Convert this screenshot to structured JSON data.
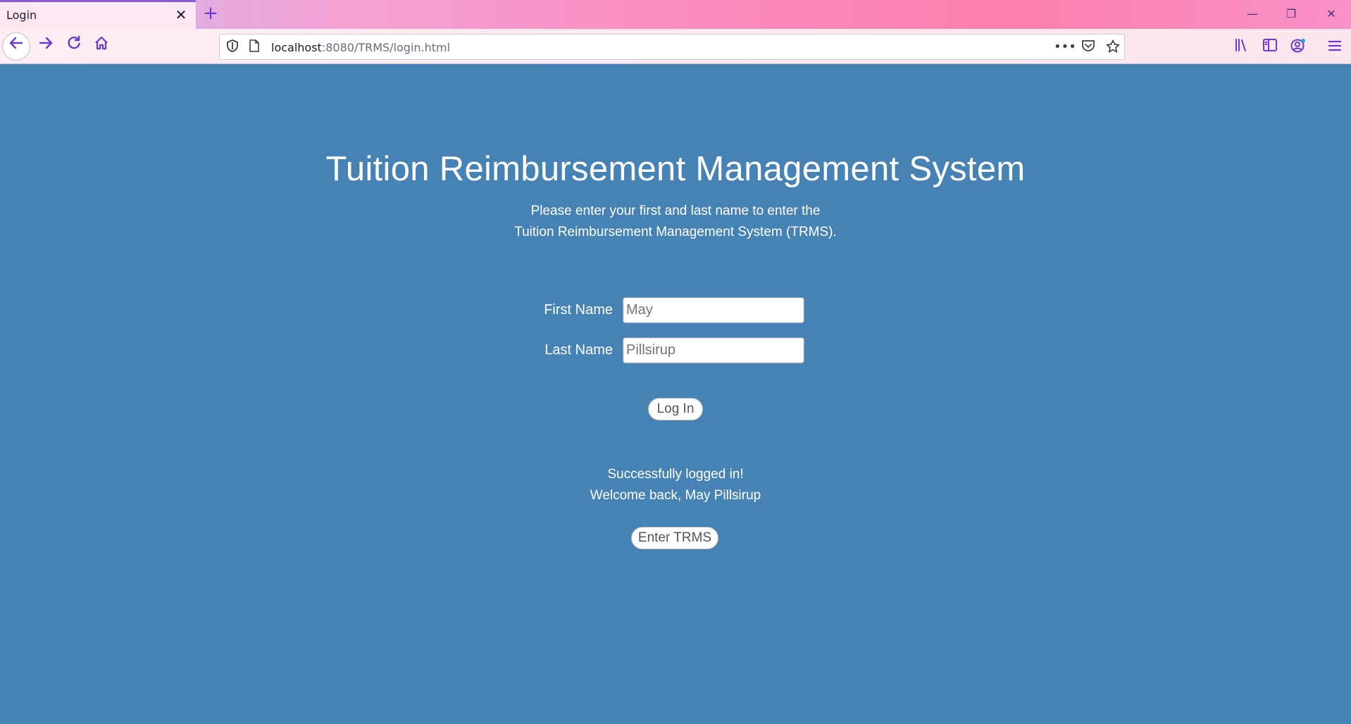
{
  "browser": {
    "tab": {
      "title": "Login",
      "close_glyph": "✕"
    },
    "new_tab_glyph": "+",
    "window_controls": {
      "minimize": "—",
      "restore": "❐",
      "close": "✕"
    },
    "url": {
      "host": "localhost",
      "rest": ":8080/TRMS/login.html"
    },
    "icons": {
      "back": "back-arrow-icon",
      "forward": "forward-arrow-icon",
      "reload": "reload-icon",
      "home": "home-icon",
      "shield": "tracking-shield-icon",
      "page": "page-icon",
      "more": "more-dots-icon",
      "pocket": "pocket-icon",
      "bookmark": "bookmark-star-icon",
      "library": "library-icon",
      "sidebar": "sidebar-icon",
      "account": "account-icon",
      "menu": "hamburger-menu-icon"
    }
  },
  "page": {
    "heading": "Tuition Reimbursement Management System",
    "intro_line1": "Please enter your first and last name to enter the",
    "intro_line2": "Tuition Reimbursement Management System (TRMS).",
    "form": {
      "first_name_label": "First Name",
      "first_name_value": "May",
      "last_name_label": "Last Name",
      "last_name_value": "Pillsirup",
      "login_button": "Log In"
    },
    "status": {
      "line1": "Successfully logged in!",
      "line2": "Welcome back, May Pillsirup"
    },
    "enter_button": "Enter TRMS"
  },
  "colors": {
    "page_background": "#4682b4",
    "accent": "#6a3ad0"
  }
}
